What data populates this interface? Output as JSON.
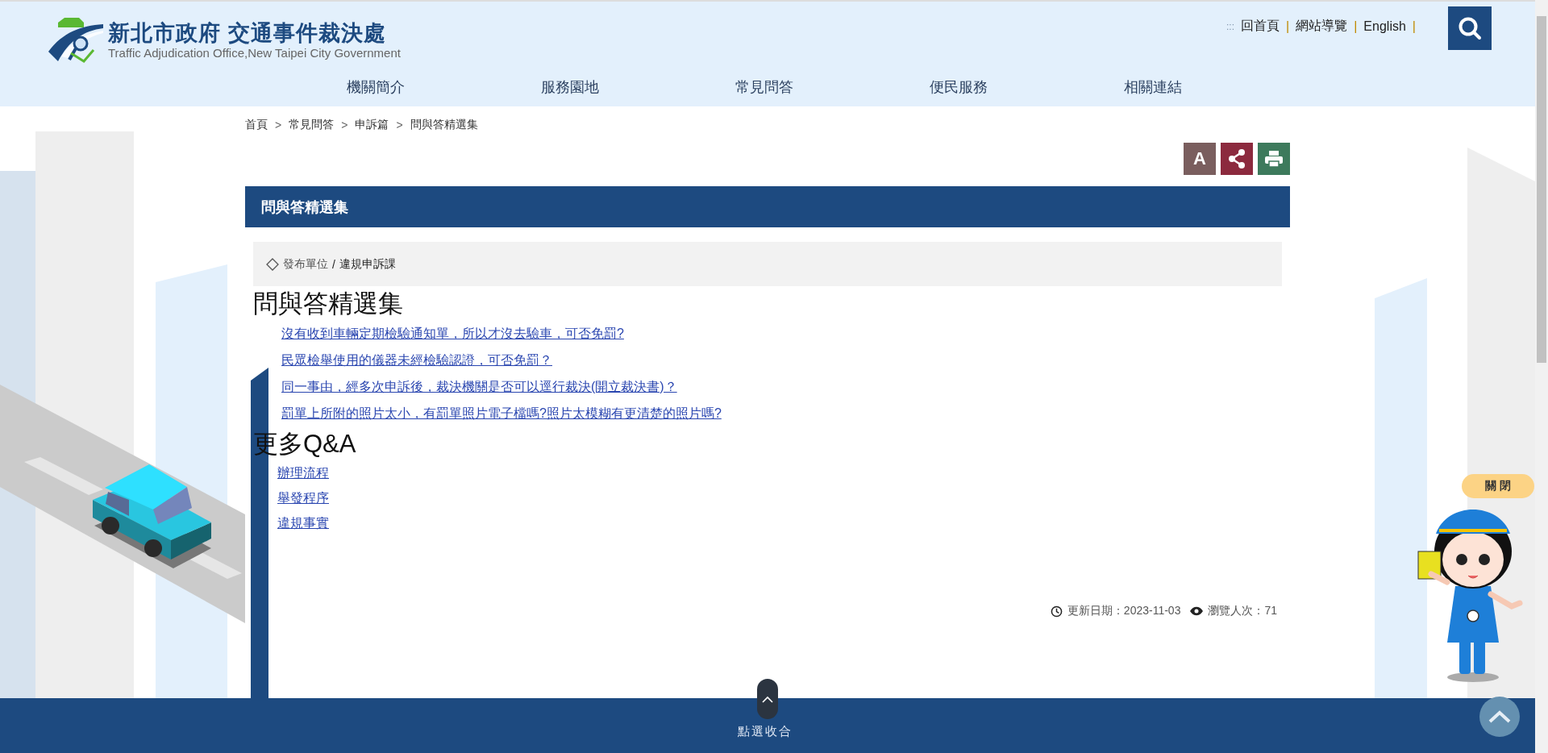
{
  "header": {
    "logo_title": "新北市政府 交通事件裁決處",
    "logo_subtitle": "Traffic Adjudication Office,New Taipei City Government",
    "accesskey": ":::",
    "top_links": [
      "回首頁",
      "網站導覽",
      "English"
    ],
    "link_separator": "|"
  },
  "nav": [
    "機關簡介",
    "服務園地",
    "常見問答",
    "便民服務",
    "相關連結"
  ],
  "breadcrumb": {
    "separator": ">",
    "items": [
      "首頁",
      "常見問答",
      "申訴篇",
      "問與答精選集"
    ]
  },
  "tools": {
    "font_size_label": "A"
  },
  "page_title": "問與答精選集",
  "publisher": {
    "label": "發布單位",
    "separator": "/",
    "value": "違規申訴課"
  },
  "sections": [
    {
      "heading": "問與答精選集",
      "kind": "questions",
      "links": [
        "沒有收到車輛定期檢驗通知單，所以才沒去驗車，可否免罰?",
        "民眾檢舉使用的儀器未經檢驗認證，可否免罰？",
        "同一事由，經多次申訴後，裁決機關是否可以逕行裁決(開立裁決書)？",
        "罰單上所附的照片太小，有罰單照片電子檔嗎?照片太模糊有更清楚的照片嗎?"
      ]
    },
    {
      "heading": "更多Q&A",
      "kind": "more",
      "links": [
        "辦理流程",
        "舉發程序",
        "違規事實"
      ]
    }
  ],
  "meta": {
    "updated": "更新日期：2023-11-03",
    "views": "瀏覽人次：71"
  },
  "footer": {
    "collapse_label": "點選收合"
  },
  "mascot": {
    "close_label": "關 閉"
  }
}
